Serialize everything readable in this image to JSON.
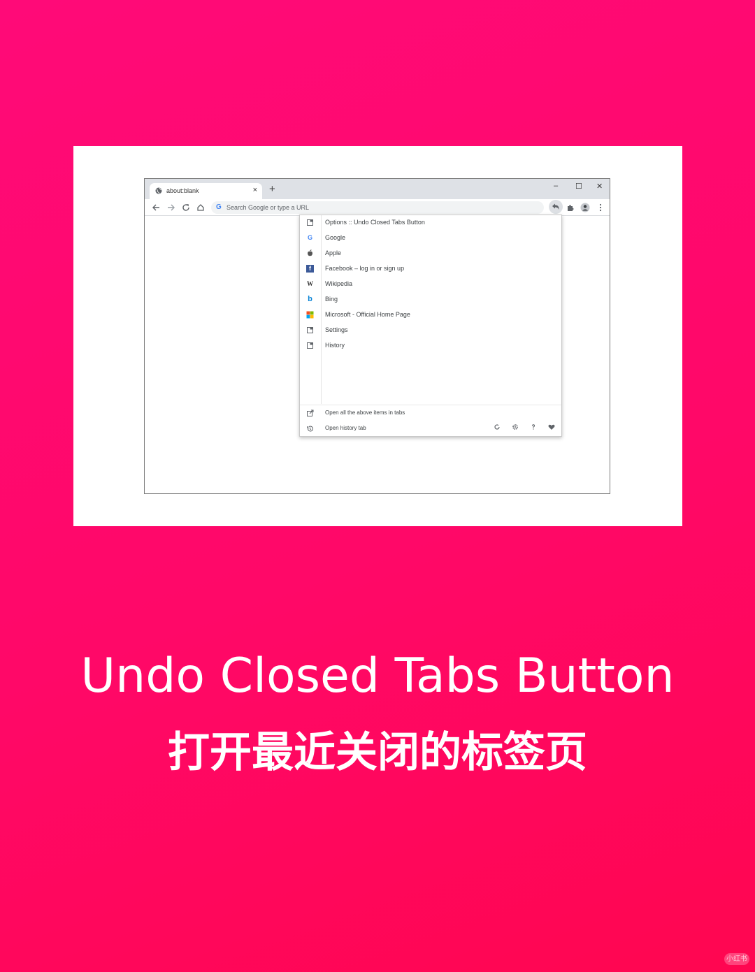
{
  "browser": {
    "tab_title": "about:blank",
    "tab_close": "×",
    "new_tab": "+",
    "window_controls": {
      "minimize": "–",
      "maximize": "☐",
      "close": "✕"
    },
    "omnibox_placeholder": "Search Google or type a URL",
    "omnibox_g": "G"
  },
  "popup": {
    "items": [
      {
        "label": "Options :: Undo Closed Tabs Button",
        "icon": "page-icon"
      },
      {
        "label": "Google",
        "icon": "google-icon"
      },
      {
        "label": "Apple",
        "icon": "apple-icon"
      },
      {
        "label": "Facebook – log in or sign up",
        "icon": "facebook-icon"
      },
      {
        "label": "Wikipedia",
        "icon": "wikipedia-icon"
      },
      {
        "label": "Bing",
        "icon": "bing-icon"
      },
      {
        "label": "Microsoft - Official Home Page",
        "icon": "microsoft-icon"
      },
      {
        "label": "Settings",
        "icon": "page-icon"
      },
      {
        "label": "History",
        "icon": "page-icon"
      }
    ],
    "footer": {
      "open_all": "Open all the above items in tabs",
      "open_history": "Open history tab"
    }
  },
  "headline": "Undo Closed Tabs Button",
  "subline": "打开最近关闭的标签页",
  "watermark": "小红书",
  "colors": {
    "accent": "#ff0a6e",
    "chrome_gray": "#dee1e6"
  }
}
